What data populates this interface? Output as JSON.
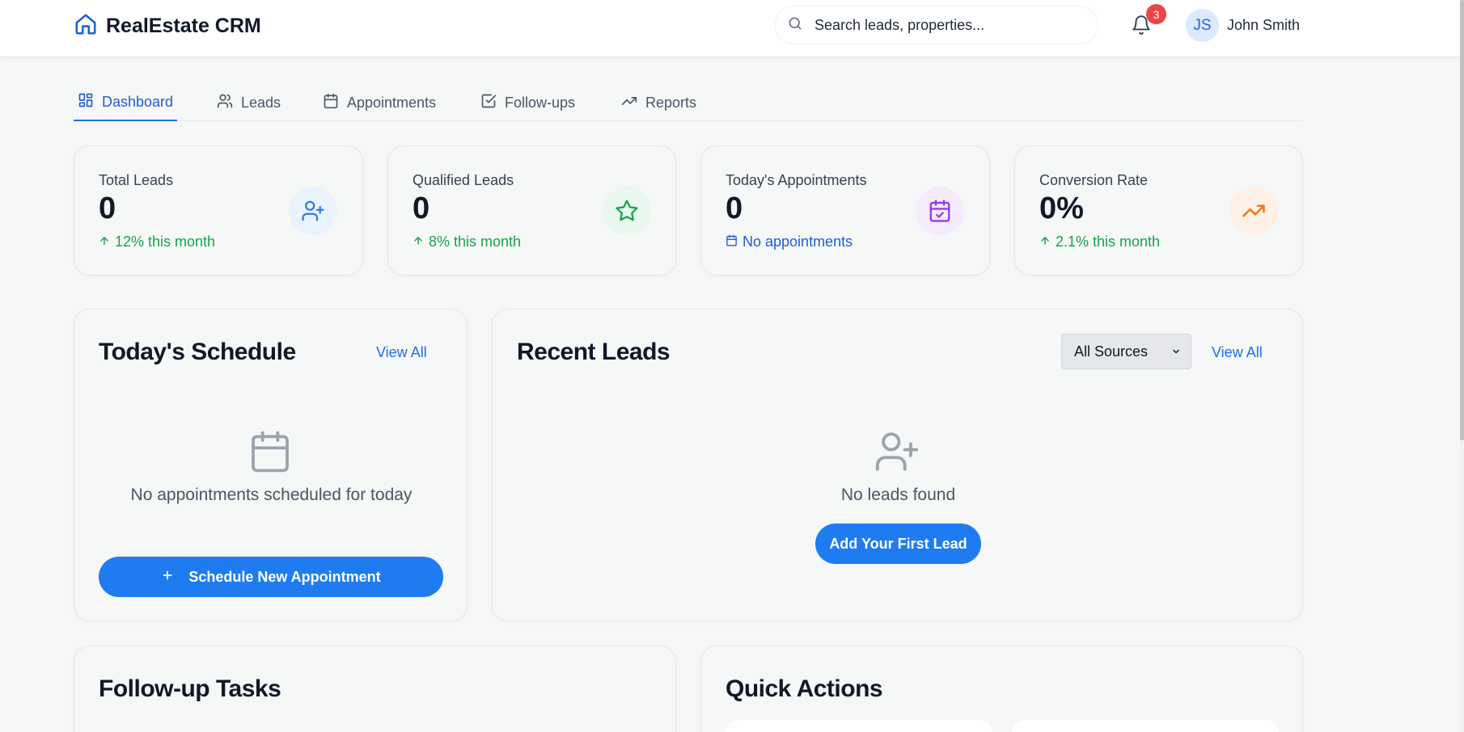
{
  "app": {
    "title": "RealEstate CRM"
  },
  "search": {
    "placeholder": "Search leads, properties..."
  },
  "notifications": {
    "count": "3"
  },
  "user": {
    "initials": "JS",
    "name": "John Smith"
  },
  "tabs": [
    {
      "label": "Dashboard",
      "icon": "dashboard-icon",
      "active": true
    },
    {
      "label": "Leads",
      "icon": "users-icon"
    },
    {
      "label": "Appointments",
      "icon": "calendar-icon"
    },
    {
      "label": "Follow-ups",
      "icon": "check-square-icon"
    },
    {
      "label": "Reports",
      "icon": "trending-up-icon"
    }
  ],
  "stats": [
    {
      "label": "Total Leads",
      "value": "0",
      "trend": "12% this month",
      "icon": "user-plus-icon",
      "color": "#2f7ae5"
    },
    {
      "label": "Qualified Leads",
      "value": "0",
      "trend": "8% this month",
      "icon": "star-icon",
      "color": "#16a34a"
    },
    {
      "label": "Today's Appointments",
      "value": "0",
      "trend": "No appointments",
      "icon": "calendar-check-icon",
      "color": "#9333ea"
    },
    {
      "label": "Conversion Rate",
      "value": "0%",
      "trend": "2.1% this month",
      "icon": "trending-up-icon",
      "color": "#f97316"
    }
  ],
  "schedule": {
    "title": "Today's Schedule",
    "view_all": "View All",
    "empty": "No appointments scheduled for today",
    "button": "Schedule New Appointment"
  },
  "recent_leads": {
    "title": "Recent Leads",
    "filter": "All Sources",
    "view_all": "View All",
    "empty": "No leads found",
    "button": "Add Your First Lead"
  },
  "followups": {
    "title": "Follow-up Tasks"
  },
  "quick_actions": {
    "title": "Quick Actions"
  },
  "colors": {
    "accent": "#1f7cf0",
    "badge": "#ef4444",
    "success": "#16a34a"
  }
}
